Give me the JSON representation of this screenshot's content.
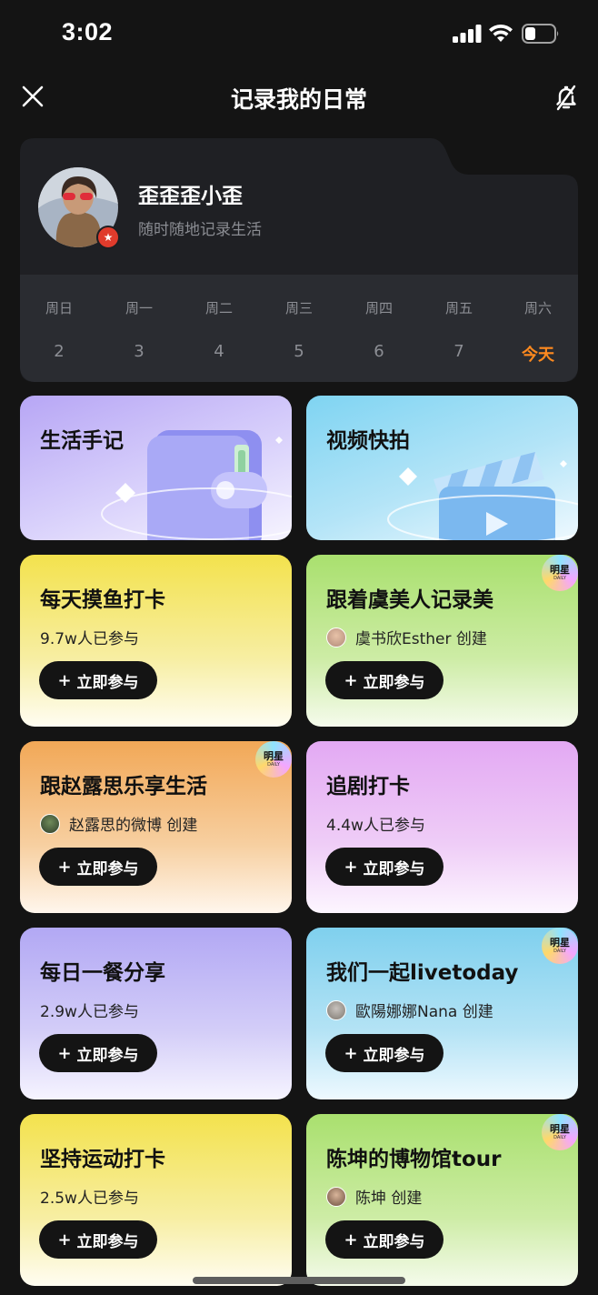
{
  "status_bar": {
    "time": "3:02"
  },
  "header": {
    "title": "记录我的日常"
  },
  "profile": {
    "name": "歪歪歪小歪",
    "bio": "随时随地记录生活",
    "week": [
      {
        "weekday": "周日",
        "date": "2"
      },
      {
        "weekday": "周一",
        "date": "3"
      },
      {
        "weekday": "周二",
        "date": "4"
      },
      {
        "weekday": "周三",
        "date": "5"
      },
      {
        "weekday": "周四",
        "date": "6"
      },
      {
        "weekday": "周五",
        "date": "7"
      },
      {
        "weekday": "周六",
        "date": "今天"
      }
    ]
  },
  "features": [
    {
      "title": "生活手记"
    },
    {
      "title": "视频快拍"
    }
  ],
  "cards": [
    {
      "title": "每天摸鱼打卡",
      "subtitle": "9.7w人已参与",
      "button": "立即参与"
    },
    {
      "title": "跟着虞美人记录美",
      "subtitle": "虞书欣Esther 创建",
      "button": "立即参与",
      "badge": "明星",
      "badge_sub": "DAILY"
    },
    {
      "title": "跟赵露思乐享生活",
      "subtitle": "赵露思的微博 创建",
      "button": "立即参与",
      "badge": "明星",
      "badge_sub": "DAILY"
    },
    {
      "title": "追剧打卡",
      "subtitle": "4.4w人已参与",
      "button": "立即参与"
    },
    {
      "title": "每日一餐分享",
      "subtitle": "2.9w人已参与",
      "button": "立即参与"
    },
    {
      "title": "我们一起livetoday",
      "subtitle": "歐陽娜娜Nana 创建",
      "button": "立即参与",
      "badge": "明星",
      "badge_sub": "DAILY"
    },
    {
      "title": "坚持运动打卡",
      "subtitle": "2.5w人已参与",
      "button": "立即参与"
    },
    {
      "title": "陈坤的博物馆tour",
      "subtitle": "陈坤 创建",
      "button": "立即参与",
      "badge": "明星",
      "badge_sub": "DAILY"
    }
  ],
  "colors": {
    "background": "#141414",
    "today": "#ff8a1f",
    "button": "#141414"
  }
}
